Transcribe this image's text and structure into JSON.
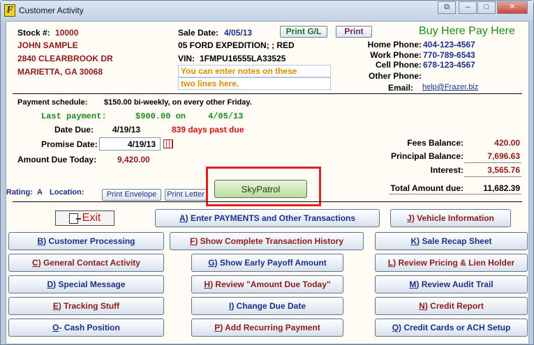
{
  "window": {
    "title": "Customer Activity",
    "icon_letter": "F",
    "controls": {
      "restore": "⧉",
      "minimize": "–",
      "maximize": "□",
      "close": "✕"
    }
  },
  "customer": {
    "stock_label": "Stock #:",
    "stock_value": "10000",
    "name": "JOHN SAMPLE",
    "address": "2840 CLEARBROOK DR",
    "city": "MARIETTA, GA 30068"
  },
  "sale": {
    "date_label": "Sale Date:",
    "date_value": "4/05/13",
    "vehicle": "05 FORD EXPEDITION; ; RED",
    "vin_label": "VIN:",
    "vin_value": "1FMPU16555LA33525",
    "note1": "You can enter notes on these",
    "note2": "two lines here.",
    "print_gl": "Print G/L",
    "print": "Print"
  },
  "brand": "Buy Here Pay Here",
  "contact": {
    "home_label": "Home Phone:",
    "home_value": "404-123-4567",
    "work_label": "Work Phone:",
    "work_value": "770-789-6543",
    "cell_label": "Cell Phone:",
    "cell_value": "678-123-4567",
    "other_label": "Other Phone:",
    "other_value": "",
    "email_label": "Email:",
    "email_value": "help@Frazer.biz"
  },
  "payment": {
    "schedule_label": "Payment schedule:",
    "schedule_value": "$150.00 bi-weekly, on every other Friday.",
    "last_payment": "Last payment:",
    "last_amount": "$900.00 on",
    "last_date": "4/05/13",
    "date_due_label": "Date Due:",
    "date_due_value": "4/19/13",
    "past_due": "839 days past due",
    "promise_label": "Promise Date:",
    "promise_value": "4/19/13",
    "amount_due_label": "Amount Due Today:",
    "amount_due_value": "9,420.00"
  },
  "balances": {
    "fees_label": "Fees Balance:",
    "fees_value": "420.00",
    "principal_label": "Principal Balance:",
    "principal_value": "7,696.63",
    "interest_label": "Interest:",
    "interest_value": "3,565.76",
    "total_label": "Total Amount due:",
    "total_value": "11,682.39"
  },
  "rating": {
    "label": "Rating:",
    "value": "A",
    "location_label": "Location:",
    "print_envelope": "Print Envelope",
    "print_letter": "Print Letter"
  },
  "skypatrol": "SkyPatrol",
  "buttons": {
    "exit": "Exit",
    "a_hot": "A",
    "a_rest": ") Enter PAYMENTS and Other Transactions",
    "j_hot": "J",
    "j_rest": ") Vehicle Information",
    "b_hot": "B",
    "b_rest": ") Customer Processing",
    "f_hot": "F",
    "f_rest": ") Show Complete Transaction History",
    "k_hot": "K",
    "k_rest": ") Sale Recap Sheet",
    "c_hot": "C",
    "c_rest": ") General Contact Activity",
    "g_hot": "G",
    "g_rest": ") Show Early Payoff Amount",
    "l_hot": "L",
    "l_rest": ") Review Pricing & Lien Holder",
    "d_hot": "D",
    "d_rest": ") Special Message",
    "h_hot": "H",
    "h_rest": ") Review \"Amount Due Today\"",
    "m_hot": "M",
    "m_rest": ") Review Audit Trail",
    "e_hot": "E",
    "e_rest": ") Tracking Stuff",
    "i_hot": "I",
    "i_rest": ") Change Due Date",
    "n_hot": "N",
    "n_rest": ") Credit Report",
    "o_hot": "O",
    "o_rest": " - Cash Position",
    "p_hot": "P",
    "p_rest": ") Add Recurring Payment",
    "q_hot": "Q",
    "q_rest": ") Credit Cards or ACH Setup"
  },
  "colors": {
    "maroon": "#8b1a1a",
    "navy": "#1b2f8a",
    "green": "#1e8a1e",
    "alert_red": "#cc1111",
    "highlight_box": "#e02020"
  }
}
